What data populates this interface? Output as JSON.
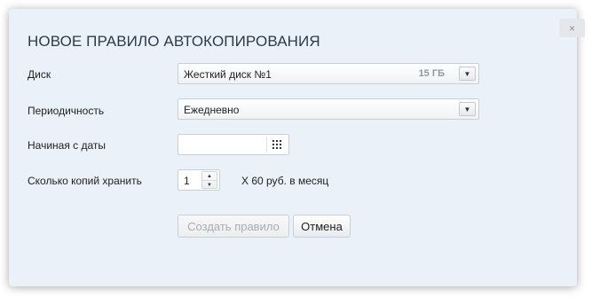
{
  "dialog": {
    "title": "НОВОЕ ПРАВИЛО АВТОКОПИРОВАНИЯ",
    "close_icon": "×"
  },
  "form": {
    "disk": {
      "label": "Диск",
      "value": "Жесткий диск №1",
      "size": "15 ГБ"
    },
    "periodicity": {
      "label": "Периодичность",
      "value": "Ежедневно"
    },
    "start_date": {
      "label": "Начиная с даты",
      "value": ""
    },
    "copies": {
      "label": "Сколько копий хранить",
      "value": "1",
      "price": "X 60 руб. в месяц"
    }
  },
  "buttons": {
    "create_label": "Создать правило",
    "cancel_label": "Отмена"
  },
  "icons": {
    "dropdown": "chevron-down-icon",
    "calendar": "calendar-grid-icon",
    "stepper_up": "triangle-up-icon",
    "stepper_down": "triangle-down-icon"
  },
  "colors": {
    "dialog_bg": "#eaf1f8",
    "title": "#2b3b4c",
    "disabled_text": "#a7adb3",
    "size_badge": "#8a9aa8"
  }
}
